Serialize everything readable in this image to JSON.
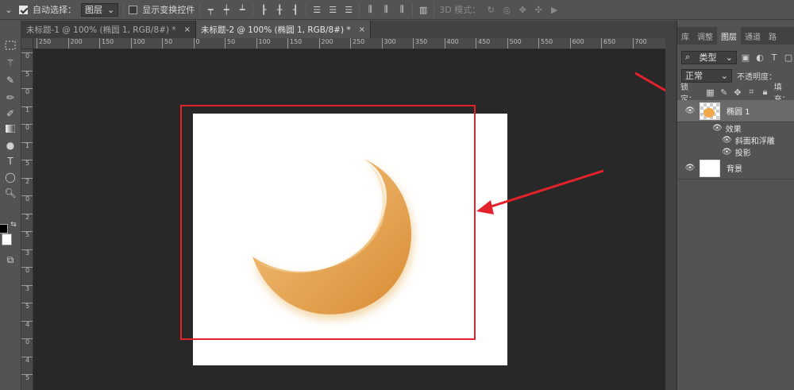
{
  "options_bar": {
    "auto_select_label": "自动选择：",
    "auto_select_value": "图层",
    "show_transform_label": "显示变换控件",
    "mode_3d_label": "3D 模式："
  },
  "tabs": [
    {
      "label": "未标题-1 @ 100% (椭圆 1, RGB/8#) *",
      "close": "×"
    },
    {
      "label": "未标题-2 @ 100% (椭圆 1, RGB/8#) *",
      "close": "×"
    }
  ],
  "ruler_h": [
    "250",
    "200",
    "150",
    "100",
    "50",
    "0",
    "50",
    "100",
    "150",
    "200",
    "250",
    "300",
    "350",
    "400",
    "450",
    "500",
    "550",
    "600",
    "650",
    "700"
  ],
  "ruler_v": [
    "0",
    "5",
    "0",
    "1",
    "0",
    "1",
    "5",
    "2",
    "0",
    "2",
    "5",
    "3",
    "0",
    "3",
    "5",
    "4",
    "0",
    "4",
    "5"
  ],
  "panel": {
    "tabs": [
      "库",
      "调整",
      "图层",
      "通道",
      "路"
    ],
    "filter_label": "类型",
    "blend_mode": "正常",
    "opacity_label": "不透明度：",
    "lock_label": "锁定：",
    "fill_label": "填充：",
    "layers": [
      {
        "name": "椭圆 1",
        "active": true
      },
      {
        "name": "背景",
        "active": false
      }
    ],
    "effects_label": "效果",
    "effect_items": [
      "斜面和浮雕",
      "投影"
    ]
  },
  "colors": {
    "annotation": "#e3232b",
    "moon_light": "#f7c784",
    "moon_dark": "#d88b33"
  }
}
